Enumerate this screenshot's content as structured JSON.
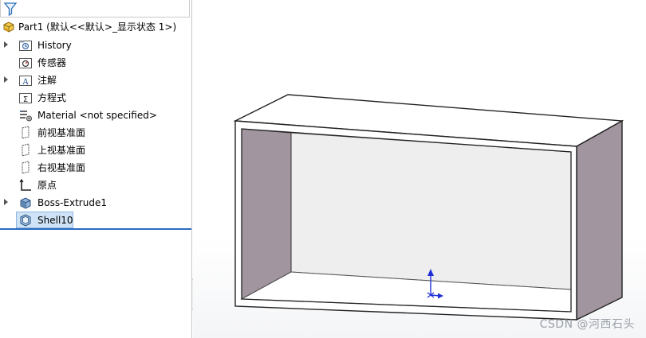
{
  "tree": {
    "root": "Part1  (默认<<默认>_显示状态 1>)",
    "items": [
      {
        "label": "History",
        "expandable": true
      },
      {
        "label": "传感器",
        "expandable": false
      },
      {
        "label": "注解",
        "expandable": true
      },
      {
        "label": "方程式",
        "expandable": false
      },
      {
        "label": "Material <not specified>",
        "expandable": false
      },
      {
        "label": "前视基准面",
        "expandable": false
      },
      {
        "label": "上视基准面",
        "expandable": false
      },
      {
        "label": "右视基准面",
        "expandable": false
      },
      {
        "label": "原点",
        "expandable": false
      },
      {
        "label": "Boss-Extrude1",
        "expandable": true
      },
      {
        "label": "Shell10",
        "expandable": false,
        "selected": true
      }
    ]
  },
  "watermark": "CSDN @河西石头",
  "colors": {
    "selection": "#cfe3f6",
    "accent_line": "#2a6bc2",
    "shell_inner_face": "#eeeeee",
    "shell_side_face": "#a0959f",
    "origin_axis": "#1f2fd6"
  }
}
